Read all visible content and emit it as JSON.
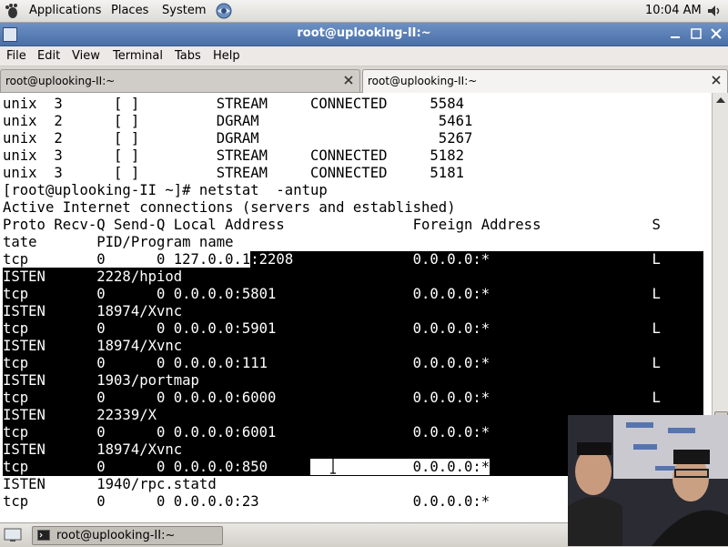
{
  "top_panel": {
    "menu_applications": "Applications",
    "menu_places": "Places",
    "menu_system": "System",
    "clock": "10:04 AM"
  },
  "window": {
    "title": "root@uplooking-II:~"
  },
  "menubar": {
    "file": "File",
    "edit": "Edit",
    "view": "View",
    "terminal": "Terminal",
    "tabs": "Tabs",
    "help": "Help"
  },
  "tabs": [
    {
      "label": "root@uplooking-II:~",
      "active": false
    },
    {
      "label": "root@uplooking-II:~",
      "active": true
    }
  ],
  "terminal": {
    "lines": [
      "unix  3      [ ]         STREAM     CONNECTED     5584",
      "unix  2      [ ]         DGRAM                     5461",
      "unix  2      [ ]         DGRAM                     5267",
      "unix  3      [ ]         STREAM     CONNECTED     5182",
      "unix  3      [ ]         STREAM     CONNECTED     5181",
      "[root@uplooking-II ~]# netstat  -antup",
      "Active Internet connections (servers and established)",
      "Proto Recv-Q Send-Q Local Address               Foreign Address             S",
      "tate       PID/Program name",
      "tcp        0      0 127.0.0.1:2208              0.0.0.0:*                   L",
      "ISTEN      2228/hpiod",
      "tcp        0      0 0.0.0.0:5801                0.0.0.0:*                   L",
      "ISTEN      18974/Xvnc",
      "tcp        0      0 0.0.0.0:5901                0.0.0.0:*                   L",
      "ISTEN      18974/Xvnc",
      "tcp        0      0 0.0.0.0:111                 0.0.0.0:*                   L",
      "ISTEN      1903/portmap",
      "tcp        0      0 0.0.0.0:6000                0.0.0.0:*                   L",
      "ISTEN      22339/X",
      "tcp        0      0 0.0.0.0:6001                0.0.0.0:*                   L",
      "ISTEN      18974/Xvnc",
      "tcp        0      0 0.0.0.0:850                 0.0.0.0:*",
      "ISTEN      1940/rpc.statd",
      "tcp        0      0 0.0.0.0:23                  0.0.0.0:*"
    ]
  },
  "taskbar": {
    "item_label": "root@uplooking-II:~"
  },
  "colors": {
    "titlebar": "#5a7fb6",
    "selection_bg": "#000000",
    "selection_fg": "#ffffff",
    "terminal_bg": "#ffffff",
    "terminal_fg": "#000000"
  }
}
